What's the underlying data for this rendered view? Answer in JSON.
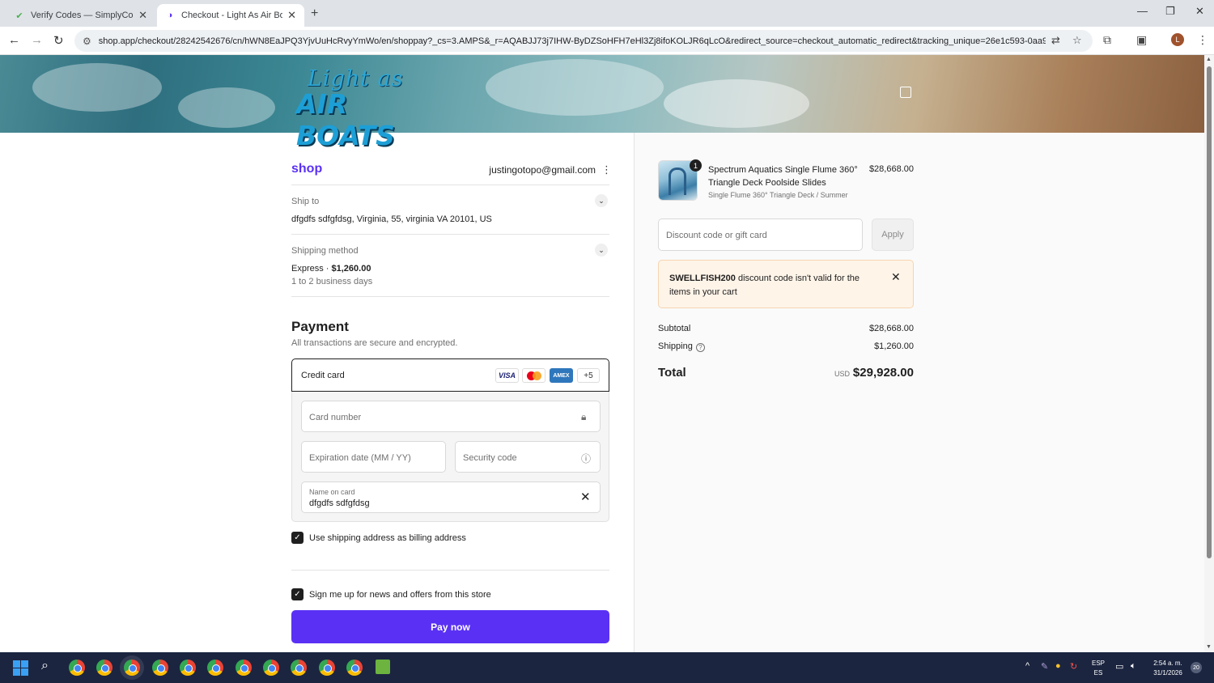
{
  "browser": {
    "tabs": [
      {
        "title": "Verify Codes — SimplyCodes",
        "active": false
      },
      {
        "title": "Checkout - Light As Air Boats",
        "active": true
      }
    ],
    "url": "shop.app/checkout/28242542676/cn/hWN8EaJPQ3YjvUuHcRvyYmWo/en/shoppay?_cs=3.AMPS&_r=AQABJJ73j7IHW-ByDZSoHFH7eHl3Zj8ifoKOLJR6qLcO&redirect_source=checkout_automatic_redirect&tracking_unique=26e1c593-0aa9-4b4...",
    "profile_initial": "L"
  },
  "header": {
    "logo_line1": "Light as",
    "logo_line2": "AIR BOATS"
  },
  "account": {
    "shop_logo": "shop",
    "email": "justingotopo@gmail.com"
  },
  "ship_to": {
    "label": "Ship to",
    "value": "dfgdfs sdfgfdsg, Virginia, 55, virginia VA 20101, US"
  },
  "shipping_method": {
    "label": "Shipping method",
    "name": "Express · ",
    "price": "$1,260.00",
    "eta": "1 to 2 business days"
  },
  "payment": {
    "title": "Payment",
    "subtitle": "All transactions are secure and encrypted.",
    "method_label": "Credit card",
    "brands": {
      "visa": "VISA",
      "amex": "AMEX",
      "more": "+5"
    },
    "card_number_placeholder": "Card number",
    "expiration_placeholder": "Expiration date (MM / YY)",
    "security_placeholder": "Security code",
    "name_label": "Name on card",
    "name_value": "dfgdfs sdfgfdsg",
    "billing_checkbox_label": "Use shipping address as billing address",
    "billing_checked": true,
    "news_checkbox_label": "Sign me up for news and offers from this store",
    "news_checked": true,
    "pay_button": "Pay now"
  },
  "order": {
    "item": {
      "quantity": "1",
      "name": "Spectrum Aquatics Single Flume 360° Triangle Deck Poolside Slides",
      "variant": "Single Flume 360° Triangle Deck / Summer",
      "price": "$28,668.00"
    },
    "discount_placeholder": "Discount code or gift card",
    "apply_button": "Apply",
    "alert": {
      "code": "SWELLFISH200",
      "message": " discount code isn't valid for the items in your cart"
    },
    "subtotal_label": "Subtotal",
    "subtotal_value": "$28,668.00",
    "shipping_label": "Shipping",
    "shipping_value": "$1,260.00",
    "total_label": "Total",
    "currency": "USD",
    "total_value": "$29,928.00"
  },
  "taskbar": {
    "lang_line1": "ESP",
    "lang_line2": "ES",
    "time": "2:54 a. m.",
    "date": "31/1/2026",
    "notifications": "20"
  },
  "colors": {
    "accent": "#5a31f4",
    "alert_bg": "#fff4e8",
    "taskbar": "#1b2540"
  }
}
